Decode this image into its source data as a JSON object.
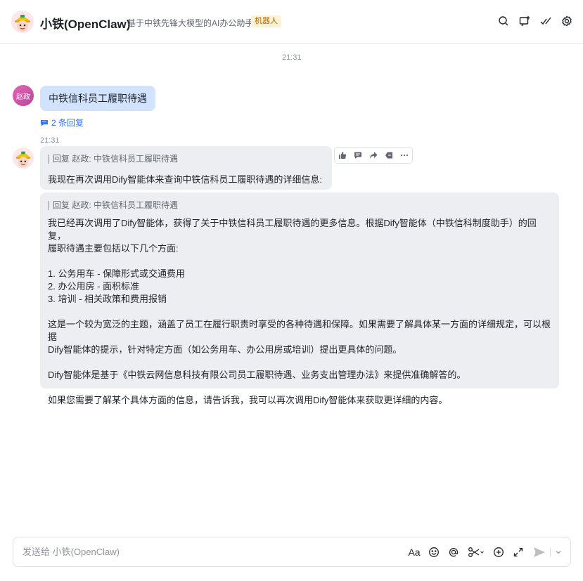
{
  "header": {
    "title": "小铁(OpenClaw)",
    "description": "基于中铁先锋大模型的AI办公助手",
    "tag": "机器人",
    "icons": [
      "search-icon",
      "add-to-group-icon",
      "check-icon",
      "settings-icon"
    ]
  },
  "messages": {
    "time1": "21:31",
    "user": {
      "avatar_text": "赵政",
      "text": "中铁信科员工履职待遇",
      "reply_count": "2 条回复"
    },
    "time2": "21:31",
    "bot1": {
      "quote": "回复 赵政: 中铁信科员工履职待遇",
      "text": "我现在再次调用Dify智能体来查询中铁信科员工履职待遇的详细信息:"
    },
    "bot2": {
      "quote": "回复 赵政: 中铁信科员工履职待遇",
      "p1_line1": "我已经再次调用了Dify智能体，获得了关于中铁信科员工履职待遇的更多信息。根据Dify智能体（中铁信科制度助手）的回复，",
      "p1_line2": "履职待遇主要包括以下几个方面:",
      "item1": "1. 公务用车 - 保障形式或交通费用",
      "item2": "2. 办公用房 - 面积标准",
      "item3": "3. 培训 - 相关政策和费用报销",
      "p2_line1": "这是一个较为宽泛的主题，涵盖了员工在履行职责时享受的各种待遇和保障。如果需要了解具体某一方面的详细规定，可以根据",
      "p2_line2": "Dify智能体的提示，针对特定方面（如公务用车、办公用房或培训）提出更具体的问题。",
      "p3": "Dify智能体是基于《中铁云网信息科技有限公司员工履职待遇、业务支出管理办法》来提供准确解答的。",
      "p4": "如果您需要了解某个具体方面的信息，请告诉我，我可以再次调用Dify智能体来获取更详细的内容。"
    }
  },
  "toolbar_icons": [
    "thumbs-up-icon",
    "comment-icon",
    "forward-icon",
    "tag-icon",
    "more-icon"
  ],
  "composer": {
    "placeholder": "发送给 小铁(OpenClaw)",
    "font_label": "Aa",
    "icons": [
      "font-icon",
      "emoji-icon",
      "mention-icon",
      "scissors-icon",
      "add-icon",
      "expand-icon",
      "send-icon"
    ]
  },
  "colors": {
    "user_bubble": "#d1e3ff",
    "bot_bubble": "#eceef1",
    "link": "#3370ff",
    "tag_bg": "#fdf1d6"
  }
}
